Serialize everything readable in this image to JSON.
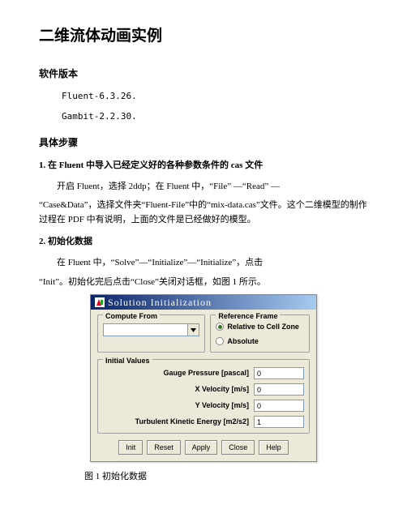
{
  "title": "二维流体动画实例",
  "sections": {
    "software": {
      "heading": "软件版本",
      "lines": [
        "Fluent-6.3.26.",
        "Gambit-2.2.30."
      ]
    },
    "steps_heading": "具体步骤",
    "step1": {
      "heading": "1. 在 Fluent 中导入已经定义好的各种参数条件的 cas 文件",
      "p1a": "开启 Fluent，选择 2ddp；在 Fluent 中，“File” —“Read” —",
      "p1b": "“Case&Data”，选择文件夹“Fluent-File”中的“mix-data.cas”文件。这个二维模型的制作过程在 PDF 中有说明，上面的文件是已经做好的模型。"
    },
    "step2": {
      "heading": "2. 初始化数据",
      "p2a": "在 Fluent 中，“Solve”—“Initialize”—“Initialize”，点击",
      "p2b": "“Init”。初始化完后点击“Close”关闭对话框，如图 1 所示。"
    }
  },
  "dialog": {
    "title": "Solution Initialization",
    "compute_from": "Compute From",
    "reference_frame": "Reference Frame",
    "radio_relative": "Relative to Cell Zone",
    "radio_absolute": "Absolute",
    "initial_values": "Initial Values",
    "fields": {
      "gauge_pressure": {
        "label": "Gauge Pressure [pascal]",
        "value": "0"
      },
      "x_velocity": {
        "label": "X Velocity [m/s]",
        "value": "0"
      },
      "y_velocity": {
        "label": "Y Velocity [m/s]",
        "value": "0"
      },
      "tke": {
        "label": "Turbulent Kinetic Energy [m2/s2]",
        "value": "1"
      }
    },
    "buttons": {
      "init": "Init",
      "reset": "Reset",
      "apply": "Apply",
      "close": "Close",
      "help": "Help"
    }
  },
  "caption": "图 1 初始化数据"
}
